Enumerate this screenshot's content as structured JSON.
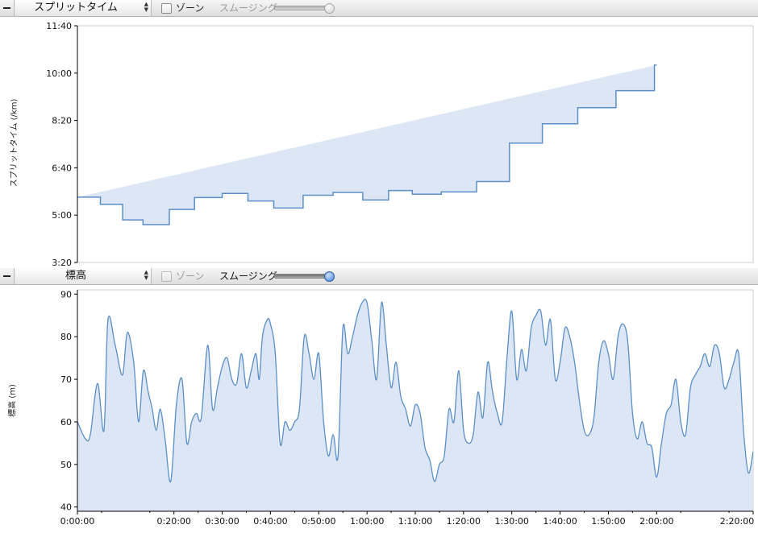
{
  "colors": {
    "fill": "#dce6f4",
    "stroke": "#5b8fc7",
    "axis": "#000000"
  },
  "top_panel": {
    "metric": "スプリットタイム",
    "zone_label": "ゾーン",
    "smoothing_label": "スムージング",
    "smoothing_level": 1.0,
    "zone_checked": false,
    "ylabel": "スプリットタイム (/km)"
  },
  "bottom_panel": {
    "metric": "標高",
    "zone_label": "ゾーン",
    "smoothing_label": "スムージング",
    "smoothing_level": 1.0,
    "zone_checked": false,
    "ylabel": "標高 (m)"
  },
  "chart_data": [
    {
      "type": "area",
      "title": "",
      "ylabel": "スプリットタイム (/km)",
      "y_unit": "seconds per km",
      "ylim": [
        200,
        700
      ],
      "y_ticks": [
        [
          200,
          "3:20"
        ],
        [
          300,
          "5:00"
        ],
        [
          400,
          "6:40"
        ],
        [
          500,
          "8:20"
        ],
        [
          600,
          "10:00"
        ],
        [
          700,
          "11:40"
        ]
      ],
      "xlim": [
        0,
        8400
      ],
      "step": true,
      "x": [
        0,
        286,
        562,
        815,
        1143,
        1455,
        1800,
        2120,
        2441,
        2806,
        3178,
        3547,
        3868,
        4163,
        4523,
        4962,
        5371,
        5780,
        6220,
        6695,
        7173
      ],
      "values": [
        338,
        323,
        290,
        280,
        312,
        337,
        346,
        330,
        315,
        342,
        348,
        332,
        352,
        344,
        349,
        371,
        452,
        493,
        527,
        563,
        617,
        630
      ],
      "x_end": 7200
    },
    {
      "type": "area",
      "title": "",
      "ylabel": "標高 (m)",
      "ylim": [
        39,
        91
      ],
      "y_ticks": [
        40,
        50,
        60,
        70,
        80,
        90
      ],
      "xlim": [
        0,
        8400
      ],
      "x_ticks": [
        [
          0,
          "0:00:00"
        ],
        [
          1200,
          "0:20:00"
        ],
        [
          1800,
          "0:30:00"
        ],
        [
          2400,
          "0:40:00"
        ],
        [
          3000,
          "0:50:00"
        ],
        [
          3600,
          "1:00:00"
        ],
        [
          4200,
          "1:10:00"
        ],
        [
          4800,
          "1:20:00"
        ],
        [
          5400,
          "1:30:00"
        ],
        [
          6000,
          "1:40:00"
        ],
        [
          6600,
          "1:50:00"
        ],
        [
          7200,
          "2:00:00"
        ],
        [
          8400,
          "2:20:00"
        ]
      ],
      "x_unit": "seconds",
      "x": [
        0,
        100,
        160,
        250,
        330,
        380,
        470,
        560,
        620,
        700,
        760,
        820,
        880,
        930,
        980,
        1030,
        1090,
        1160,
        1230,
        1300,
        1360,
        1420,
        1480,
        1540,
        1620,
        1680,
        1740,
        1800,
        1860,
        1920,
        1980,
        2040,
        2100,
        2160,
        2220,
        2260,
        2300,
        2360,
        2400,
        2460,
        2520,
        2580,
        2640,
        2700,
        2760,
        2820,
        2880,
        2940,
        3000,
        3060,
        3120,
        3180,
        3240,
        3300,
        3360,
        3420,
        3480,
        3540,
        3600,
        3660,
        3720,
        3780,
        3840,
        3900,
        3960,
        4020,
        4080,
        4140,
        4200,
        4260,
        4320,
        4380,
        4440,
        4500,
        4560,
        4620,
        4680,
        4740,
        4800,
        4860,
        4920,
        4980,
        5040,
        5100,
        5160,
        5220,
        5280,
        5340,
        5400,
        5460,
        5520,
        5580,
        5640,
        5700,
        5760,
        5820,
        5880,
        5940,
        6000,
        6060,
        6120,
        6180,
        6240,
        6300,
        6360,
        6420,
        6480,
        6540,
        6600,
        6660,
        6720,
        6780,
        6840,
        6900,
        6960,
        7020,
        7080,
        7140,
        7200,
        7260,
        7320,
        7380,
        7440,
        7500,
        7560,
        7620,
        7680,
        7740,
        7800,
        7860,
        7920,
        7980,
        8040,
        8100,
        8160,
        8220,
        8280,
        8340,
        8400
      ],
      "values": [
        60,
        56,
        57,
        69,
        58,
        84,
        78,
        71,
        81,
        74,
        60,
        72,
        67,
        63,
        58,
        63,
        56,
        46,
        64,
        70,
        55,
        60,
        62,
        61,
        78,
        63,
        68,
        73,
        75,
        70,
        69,
        76,
        68,
        72,
        76,
        70,
        80,
        84,
        83,
        76,
        55,
        60,
        58,
        60,
        63,
        80,
        76,
        70,
        76,
        60,
        52,
        57,
        52,
        82,
        76,
        80,
        85,
        88,
        88,
        79,
        70,
        88,
        78,
        68,
        74,
        66,
        63,
        59,
        64,
        62,
        54,
        51,
        46,
        50,
        52,
        63,
        60,
        72,
        58,
        55,
        57,
        67,
        61,
        74,
        67,
        62,
        60,
        75,
        86,
        70,
        77,
        72,
        82,
        85,
        86,
        78,
        84,
        70,
        74,
        82,
        80,
        74,
        65,
        58,
        57,
        61,
        74,
        79,
        76,
        70,
        80,
        83,
        79,
        62,
        56,
        60,
        55,
        54,
        47,
        55,
        62,
        64,
        70,
        60,
        57,
        68,
        71,
        73,
        76,
        73,
        78,
        76,
        68,
        70,
        74,
        76,
        58,
        48,
        53,
        51,
        52,
        51,
        50
      ]
    }
  ]
}
